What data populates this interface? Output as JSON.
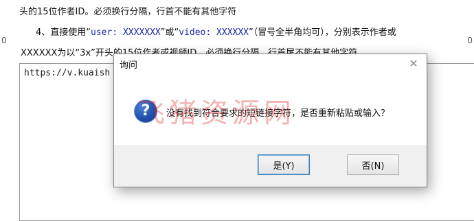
{
  "background": {
    "line1": "头的15位作者ID。必须换行分隔，行首不能有其他字符",
    "line2_prefix": "4、直接使用“",
    "line2_code1": "user: XXXXXXX",
    "line2_mid1": "”或“",
    "line2_code2": "video: XXXXXX",
    "line2_suffix": "”（冒号全半角均可），分别表示作者或",
    "line3": "XXXXXX为以“3x”开头的15位作者或视频ID。必须换行分隔，行首尾不能有其他字符",
    "left_mark": "0",
    "right_mark": "0"
  },
  "input": {
    "value": "https://v.kuaish"
  },
  "dialog": {
    "title": "询问",
    "close_symbol": "✕",
    "icon_symbol": "?",
    "message": "没有找到符合要求的短链接字符，是否重新粘贴或输入？",
    "yes_label": "是(Y)",
    "no_label": "否(N)"
  },
  "watermark": {
    "text": "飞猪资源网"
  },
  "colors": {
    "code_blue": "#1a2aa8",
    "dialog_bg": "#f0f0f0",
    "default_button_border": "#3c7fb1"
  }
}
